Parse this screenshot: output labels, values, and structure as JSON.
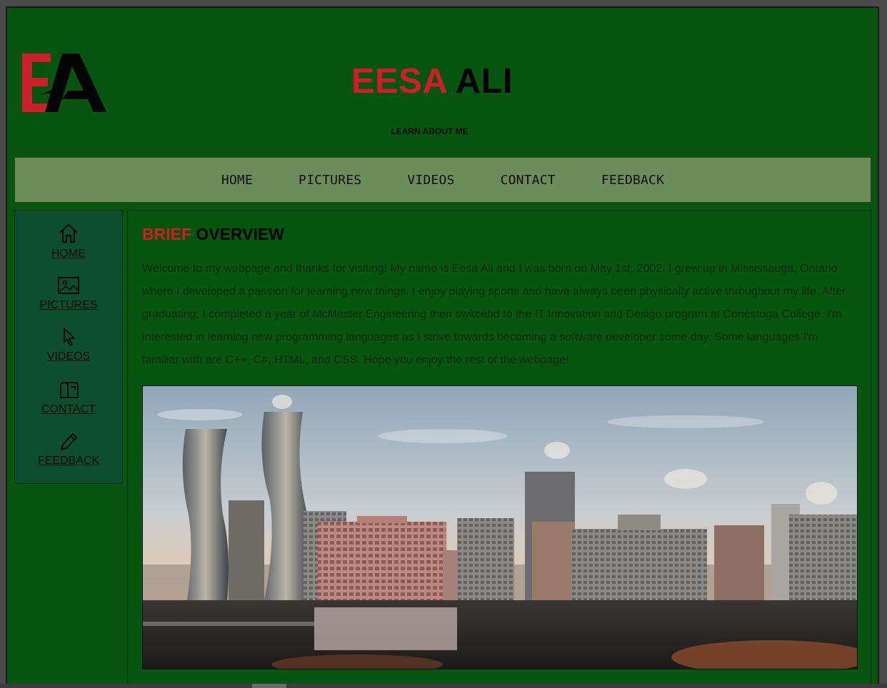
{
  "header": {
    "logo_text": "EA",
    "title_first": "EESA",
    "title_last": "ALI",
    "subtitle": "LEARN ABOUT ME"
  },
  "nav": {
    "items": [
      {
        "label": "HOME"
      },
      {
        "label": "PICTURES"
      },
      {
        "label": "VIDEOS"
      },
      {
        "label": "CONTACT"
      },
      {
        "label": "FEEDBACK"
      }
    ]
  },
  "sidebar": {
    "items": [
      {
        "label": "HOME",
        "icon": "house-icon"
      },
      {
        "label": "PICTURES",
        "icon": "image-icon"
      },
      {
        "label": "VIDEOS",
        "icon": "cursor-icon"
      },
      {
        "label": "CONTACT",
        "icon": "mailbox-icon"
      },
      {
        "label": "FEEDBACK",
        "icon": "pencil-icon"
      }
    ]
  },
  "main": {
    "heading_first": "BRIEF",
    "heading_rest": "OVERVIEW",
    "paragraph": "Welcome to my webpage and thanks for visiting! My name is Eesa Ali and I was born on May 1st, 2002. I grew up in Mississauga, Ontario where I developed a passion for learning new things. I enjoy playing sports and have always been physically active throughout my life. After graduating, I completed a year of McMaster Engineering then switcehd to the IT Innovation and Design program at Conestoga College. I'm interested in learning new programming languages as I strive towards becoming a software developer some day. Some languages I'm familiar with are C++, C#, HTML, and CSS. Hope you enjoy the rest of the webpage!"
  },
  "colors": {
    "page_bg": "#075510",
    "accent_red": "#cc1f2a",
    "nav_bg": "#6c8c59",
    "sidebar_bg": "#0e4e30"
  }
}
